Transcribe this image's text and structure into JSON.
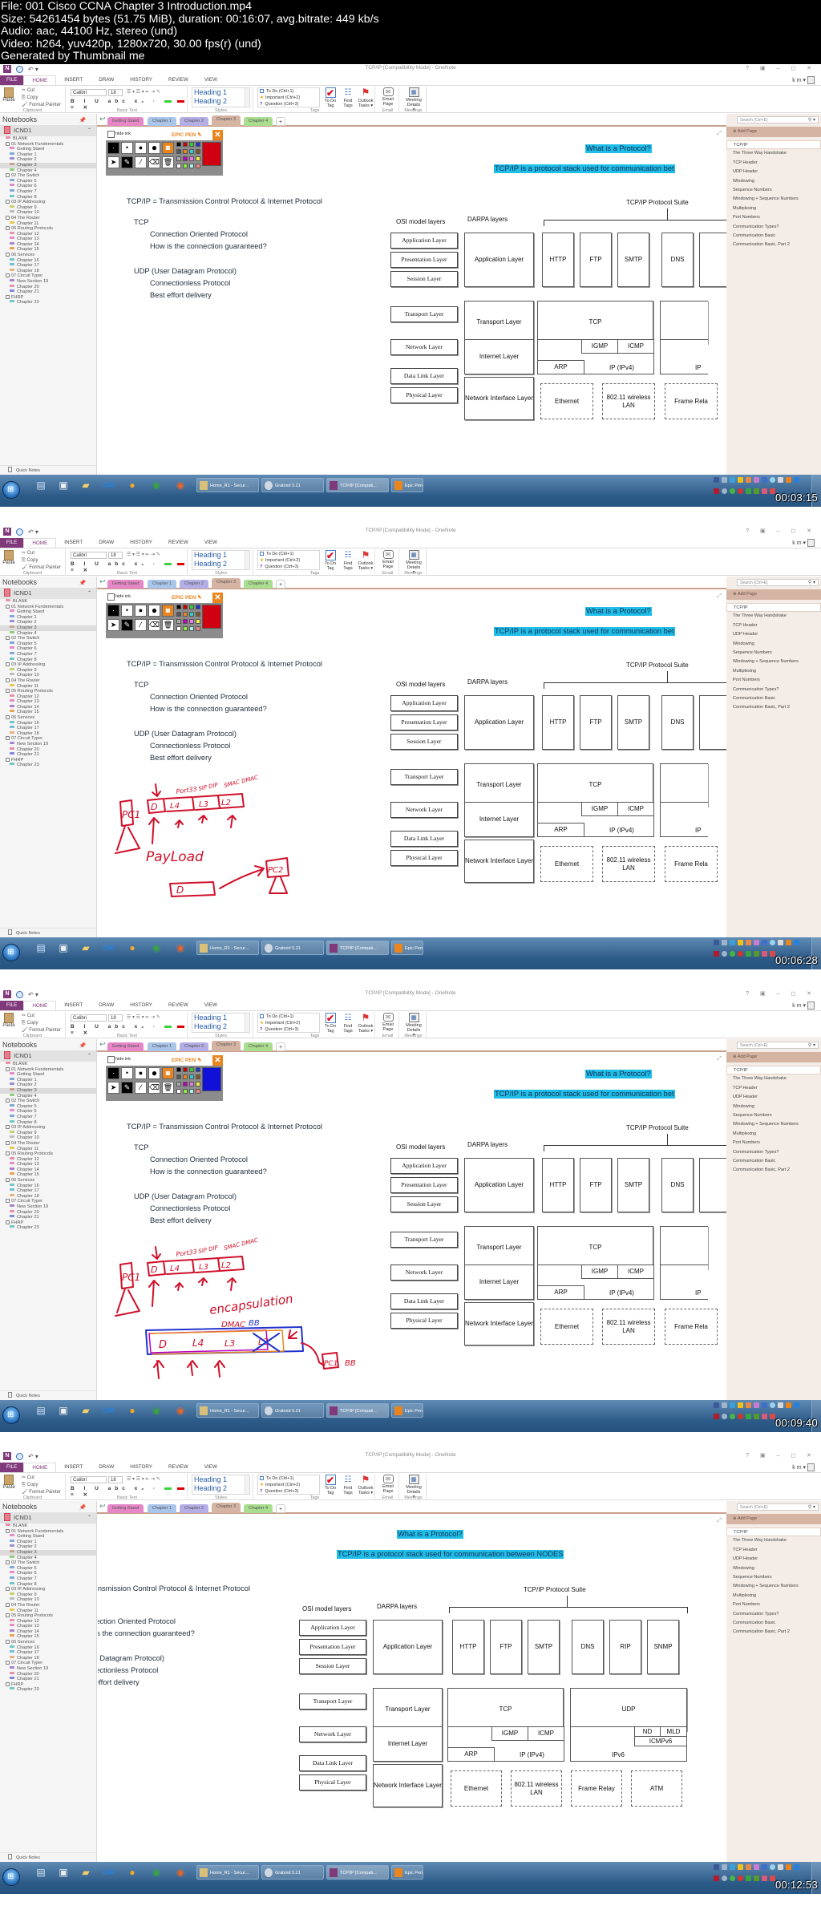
{
  "info": {
    "lines": [
      "File: 001 Cisco CCNA Chapter 3 Introduction.mp4",
      "Size: 54261454 bytes (51.75 MiB), duration: 00:16:07, avg.bitrate: 449 kb/s",
      "Audio: aac, 44100 Hz, stereo (und)",
      "Video: h264, yuv420p, 1280x720, 30.00 fps(r) (und)",
      "Generated by Thumbnail me"
    ]
  },
  "app": {
    "window_title": "TCP/IP [Compatibility Mode] - OneNote",
    "window_controls": "? ▣ – ◻ ✕",
    "user": "k m ▾",
    "ribbon_tabs": [
      "FILE",
      "HOME",
      "INSERT",
      "DRAW",
      "HISTORY",
      "REVIEW",
      "VIEW"
    ],
    "active_tab": "HOME",
    "clipboard": {
      "paste": "Paste",
      "cut": "Cut",
      "copy": "Copy",
      "format_painter": "Format Painter",
      "label": "Clipboard"
    },
    "basic_text": {
      "font": "Calibri",
      "size": "18",
      "label": "Basic Text",
      "format_buttons": "B I U abc x₂ ·"
    },
    "styles": {
      "heading1": "Heading 1",
      "heading2": "Heading 2",
      "label": "Styles"
    },
    "tags": {
      "todo": "To Do (Ctrl+1)",
      "important": "Important (Ctrl+2)",
      "question": "Question (Ctrl+3)",
      "label": "Tags"
    },
    "buttons": {
      "todo_tag": "To Do Tag",
      "find_tags": "Find Tags",
      "outlook_tasks": "Outlook Tasks ▾",
      "email_page": "Email Page",
      "meeting_details": "Meeting Details ▾",
      "email_label": "Email",
      "meetings_label": "Meetings"
    }
  },
  "notebooks": {
    "title": "Notebooks",
    "current": "ICND1",
    "sections": [
      {
        "label": "BLANK",
        "level": 1,
        "color": "#e68fa8"
      },
      {
        "label": "01 Network Fundementals",
        "level": 1,
        "group": true
      },
      {
        "label": "Getting Staed",
        "level": 2,
        "color": "#e688c8"
      },
      {
        "label": "Chapter 1",
        "level": 2,
        "color": "#7fa7d8"
      },
      {
        "label": "Chapter 2",
        "level": 2,
        "color": "#9a8fd4"
      },
      {
        "label": "Chapter 3",
        "level": 2,
        "color": "#c9a08b",
        "selected": true
      },
      {
        "label": "Chapter 4",
        "level": 2,
        "color": "#8fcf7a"
      },
      {
        "label": "02 The Switch",
        "level": 1,
        "group": true
      },
      {
        "label": "Chapter 5",
        "level": 2,
        "color": "#7fa7d8"
      },
      {
        "label": "Chapter 6",
        "level": 2,
        "color": "#e688c8"
      },
      {
        "label": "Chapter 7",
        "level": 2,
        "color": "#7fa7d8"
      },
      {
        "label": "Chapter 8",
        "level": 2,
        "color": "#6fc7c7"
      },
      {
        "label": "03 IP Addressing",
        "level": 1,
        "group": true
      },
      {
        "label": "Chapter 9",
        "level": 2,
        "color": "#c7cf6f"
      },
      {
        "label": "Chapter 10",
        "level": 2,
        "color": "#bbbbbb"
      },
      {
        "label": "04 The Router",
        "level": 1,
        "group": true
      },
      {
        "label": "Chapter 11",
        "level": 2,
        "color": "#e8c94f"
      },
      {
        "label": "05 Routing Protocols",
        "level": 1,
        "group": true
      },
      {
        "label": "Chapter 12",
        "level": 2,
        "color": "#e68fa8"
      },
      {
        "label": "Chapter 13",
        "level": 2,
        "color": "#e688c8"
      },
      {
        "label": "Chapter 14",
        "level": 2,
        "color": "#a87fd0"
      },
      {
        "label": "Chapter 15",
        "level": 2,
        "color": "#e8a24f"
      },
      {
        "label": "06 Services",
        "level": 1,
        "group": true
      },
      {
        "label": "Chapter 16",
        "level": 2,
        "color": "#6fc7c7"
      },
      {
        "label": "Chapter 17",
        "level": 2,
        "color": "#6fbfd8"
      },
      {
        "label": "Chapter 18",
        "level": 2,
        "color": "#e8b07f"
      },
      {
        "label": "07 Circuit Typer",
        "level": 1,
        "group": true
      },
      {
        "label": "New Section 19",
        "level": 2,
        "color": "#a87fd0"
      },
      {
        "label": "Chapter 20",
        "level": 2,
        "color": "#e68fa8"
      },
      {
        "label": "Chapter 21",
        "level": 2,
        "color": "#7f87d8"
      },
      {
        "label": "FHRP",
        "level": 1,
        "group": true
      },
      {
        "label": "Chapter 23",
        "level": 2,
        "color": "#6fc7c7"
      }
    ],
    "quick_notes": "Quick Notes"
  },
  "section_tabs": [
    {
      "label": "Getting Staed",
      "color": "#e688c8"
    },
    {
      "label": "Chapter 1",
      "color": "#a9c5ea"
    },
    {
      "label": "Chapter 2",
      "color": "#b5aee6"
    },
    {
      "label": "Chapter 3",
      "color": "#d5b4a3",
      "active": true
    },
    {
      "label": "Chapter 4",
      "color": "#a9dd8f"
    },
    {
      "label": "+",
      "add": true
    }
  ],
  "pages": {
    "search_placeholder": "Search (Ctrl+E)",
    "add_page": "Add Page",
    "items": [
      "TCP/IP",
      "The Three Way Handshake",
      "TCP Header",
      "UDP Header",
      "Windowing",
      "Sequence Numbers",
      "Windowing + Sequence Numbers",
      "Multiplexing",
      "Port Numbers",
      "Communication Types?",
      "Communication Basic",
      "Communication Basic, Part 2"
    ],
    "current": "TCP/IP"
  },
  "epic_pen": {
    "hide_ink": "hide ink",
    "brand": "EPIC PEN ✎",
    "close": "✕",
    "palette": [
      "#000000",
      "#cc0000",
      "#33cc33",
      "#2233cc",
      "#555555",
      "#e8851f",
      "#33cccc",
      "#7a5a2a",
      "#aaaaaa",
      "#bb00bb",
      "#ee77ee",
      "#eeee44",
      "#ffffff",
      "#88ee44",
      "#aaeeee",
      "#ee8888"
    ]
  },
  "note": {
    "title_line": "TCP/IP =  Transmission Control Protocol & Internet Protocol",
    "tcp": "TCP",
    "tcp_points": [
      "Connection Oriented Protocol",
      "How is the connection guaranteed?"
    ],
    "udp": "UDP (User Datagram Protocol)",
    "udp_points": [
      "Connectionless Protocol",
      "Best effort delivery"
    ],
    "question": "What is a Protocol?",
    "definition_full": "TCP/IP is a protocol stack used for communication between NODES",
    "definition_cut": "TCP/IP is a protocol stack used for communication bet",
    "highlight_color": "#1ebee8"
  },
  "diagram": {
    "suite_title": "TCP/IP Protocol Suite",
    "osi_title": "OSI model layers",
    "darpa_title": "DARPA layers",
    "osi_layers": [
      "Application Layer",
      "Presentation Layer",
      "Session Layer",
      "Transport Layer",
      "Network Layer",
      "Data Link Layer",
      "Physical Layer"
    ],
    "darpa_layers": [
      "Application Layer",
      "Transport Layer",
      "Internet Layer",
      "Network Interface Layer"
    ],
    "app_protocols": [
      "HTTP",
      "FTP",
      "SMTP",
      "DNS",
      "RIP",
      "SNMP"
    ],
    "transport_protocols": [
      "TCP",
      "UDP"
    ],
    "internet_v4": {
      "igmp": "IGMP",
      "icmp": "ICMP",
      "arp": "ARP",
      "ip": "IP (IPv4)"
    },
    "internet_v6": {
      "nd": "ND",
      "mld": "MLD",
      "icmpv6": "ICMPv6",
      "ipv6": "IPv6"
    },
    "link_protocols": [
      "Ethernet",
      "802.11 wireless LAN",
      "Frame Relay",
      "ATM"
    ],
    "link_protocols_cut": [
      "Ethernet",
      "802.11 wireless LAN",
      "Frame Rela"
    ],
    "ip_cut": "IP"
  },
  "ink": {
    "frame2": {
      "labels": [
        "PC1",
        "D",
        "L4",
        "L3",
        "L2",
        "Port33",
        "SIP DIP",
        "SMAC DMAC",
        "PayLoad",
        "D",
        "PC2"
      ]
    },
    "frame3": {
      "labels": [
        "PC1",
        "D",
        "L4",
        "L3",
        "L2",
        "Port33",
        "SIP DIP",
        "SMAC DMAC",
        "encapsulation",
        "DMAC",
        "BB",
        "D",
        "L4",
        "L3",
        "L2",
        "PC1",
        "BB"
      ]
    }
  },
  "taskbar": {
    "start": "Start",
    "pinned": [
      "Calculator",
      "Remote Desktop",
      "Windows Explorer",
      "Outlook",
      "Media Player",
      "Chrome",
      "Firefox"
    ],
    "tasks": [
      "Home_R1 - Secur...",
      "Graboid 5.21",
      "TCP/IP [Compati...",
      "Epic Pen"
    ]
  },
  "frames": [
    {
      "timestamp": "00:03:15",
      "ink": "none",
      "epic_color": "#d00010",
      "scrolled": false
    },
    {
      "timestamp": "00:06:28",
      "ink": "frame2",
      "epic_color": "#d00010",
      "scrolled": false
    },
    {
      "timestamp": "00:09:40",
      "ink": "frame3",
      "epic_color": "#1010d8",
      "scrolled": false
    },
    {
      "timestamp": "00:12:53",
      "ink": "none",
      "epic_color": "#d00010",
      "scrolled": true
    }
  ]
}
